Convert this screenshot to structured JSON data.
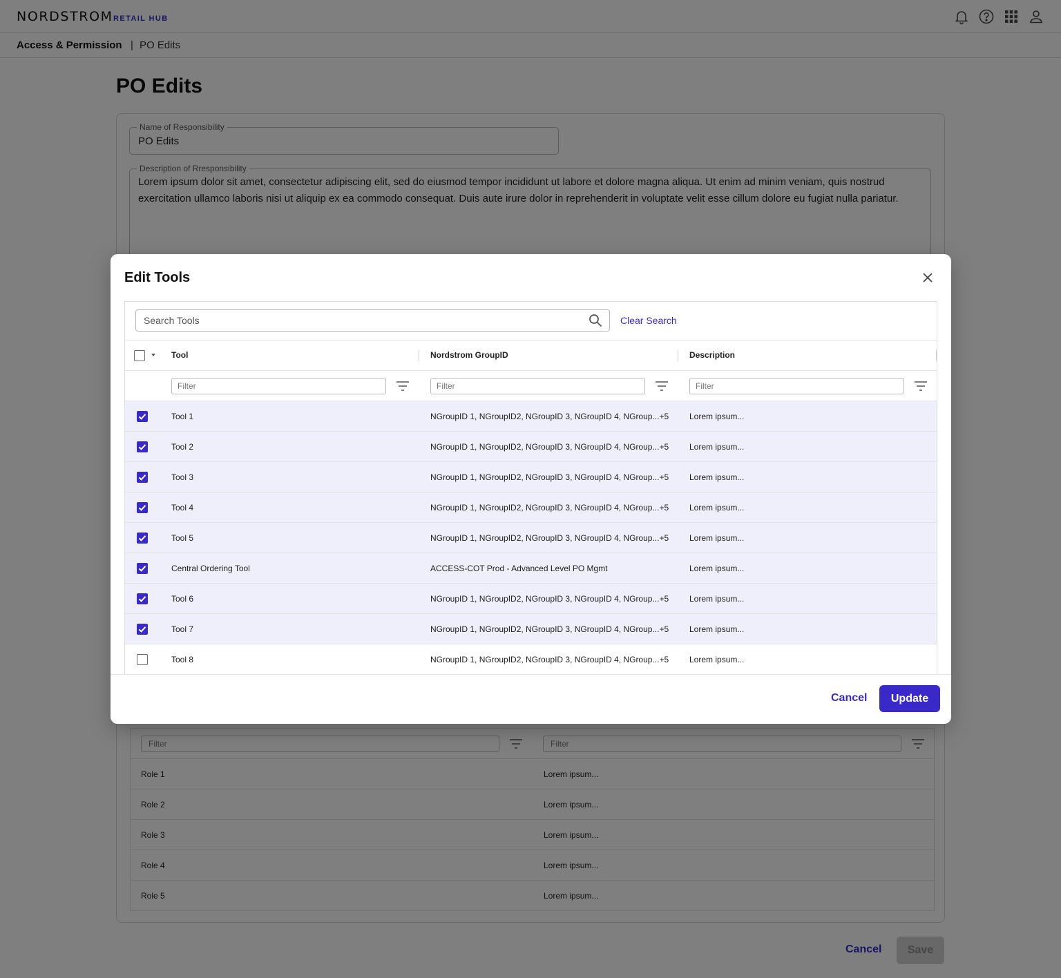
{
  "header": {
    "brand": "NORDSTROM",
    "brand_sub": "RETAIL HUB",
    "icons": [
      "bell-icon",
      "help-icon",
      "apps-grid-icon",
      "account-icon"
    ]
  },
  "breadcrumb": {
    "section": "Access & Permission",
    "separator": "|",
    "current": "PO Edits"
  },
  "page": {
    "title": "PO Edits",
    "name_label": "Name of Responsibility",
    "name_value": "PO Edits",
    "description_label": "Description of Rresponsibility",
    "description_value": "Lorem ipsum dolor sit amet, consectetur adipiscing elit, sed do eiusmod tempor incididunt ut labore et dolore magna aliqua. Ut enim ad minim veniam, quis nostrud exercitation ullamco laboris nisi ut aliquip ex ea commodo consequat. Duis aute irure dolor in reprehenderit in voluptate velit esse cillum dolore eu fugiat nulla pariatur.",
    "roles_filter_placeholder": "Filter",
    "roles": [
      {
        "name": "Role 1",
        "description": "Lorem ipsum..."
      },
      {
        "name": "Role 2",
        "description": "Lorem ipsum..."
      },
      {
        "name": "Role 3",
        "description": "Lorem ipsum..."
      },
      {
        "name": "Role 4",
        "description": "Lorem ipsum..."
      },
      {
        "name": "Role 5",
        "description": "Lorem ipsum..."
      }
    ],
    "cancel_label": "Cancel",
    "save_label": "Save"
  },
  "modal": {
    "title": "Edit Tools",
    "search_placeholder": "Search Tools",
    "clear_search_label": "Clear Search",
    "columns": [
      "Tool",
      "Nordstrom GroupID",
      "Description"
    ],
    "filter_placeholder": "Filter",
    "rows": [
      {
        "checked": true,
        "tool": "Tool 1",
        "group": "NGroupID 1, NGroupID2, NGroupID 3, NGroupID 4, NGroup...+5",
        "description": "Lorem ipsum..."
      },
      {
        "checked": true,
        "tool": "Tool 2",
        "group": "NGroupID 1, NGroupID2, NGroupID 3, NGroupID 4, NGroup...+5",
        "description": "Lorem ipsum..."
      },
      {
        "checked": true,
        "tool": "Tool 3",
        "group": "NGroupID 1, NGroupID2, NGroupID 3, NGroupID 4, NGroup...+5",
        "description": "Lorem ipsum..."
      },
      {
        "checked": true,
        "tool": "Tool 4",
        "group": "NGroupID 1, NGroupID2, NGroupID 3, NGroupID 4, NGroup...+5",
        "description": "Lorem ipsum..."
      },
      {
        "checked": true,
        "tool": "Tool 5",
        "group": "NGroupID 1, NGroupID2, NGroupID 3, NGroupID 4, NGroup...+5",
        "description": "Lorem ipsum..."
      },
      {
        "checked": true,
        "tool": "Central Ordering Tool",
        "group": "ACCESS-COT Prod - Advanced Level PO Mgmt",
        "description": "Lorem ipsum..."
      },
      {
        "checked": true,
        "tool": "Tool 6",
        "group": "NGroupID 1, NGroupID2, NGroupID 3, NGroupID 4, NGroup...+5",
        "description": "Lorem ipsum..."
      },
      {
        "checked": true,
        "tool": "Tool 7",
        "group": "NGroupID 1, NGroupID2, NGroupID 3, NGroupID 4, NGroup...+5",
        "description": "Lorem ipsum..."
      },
      {
        "checked": false,
        "tool": "Tool 8",
        "group": "NGroupID 1, NGroupID2, NGroupID 3, NGroupID 4, NGroup...+5",
        "description": "Lorem ipsum..."
      }
    ],
    "cancel_label": "Cancel",
    "update_label": "Update"
  },
  "colors": {
    "accent": "#3a29c9",
    "selected_row": "#efeefb",
    "overlay": "rgba(0,0,0,0.5)"
  }
}
